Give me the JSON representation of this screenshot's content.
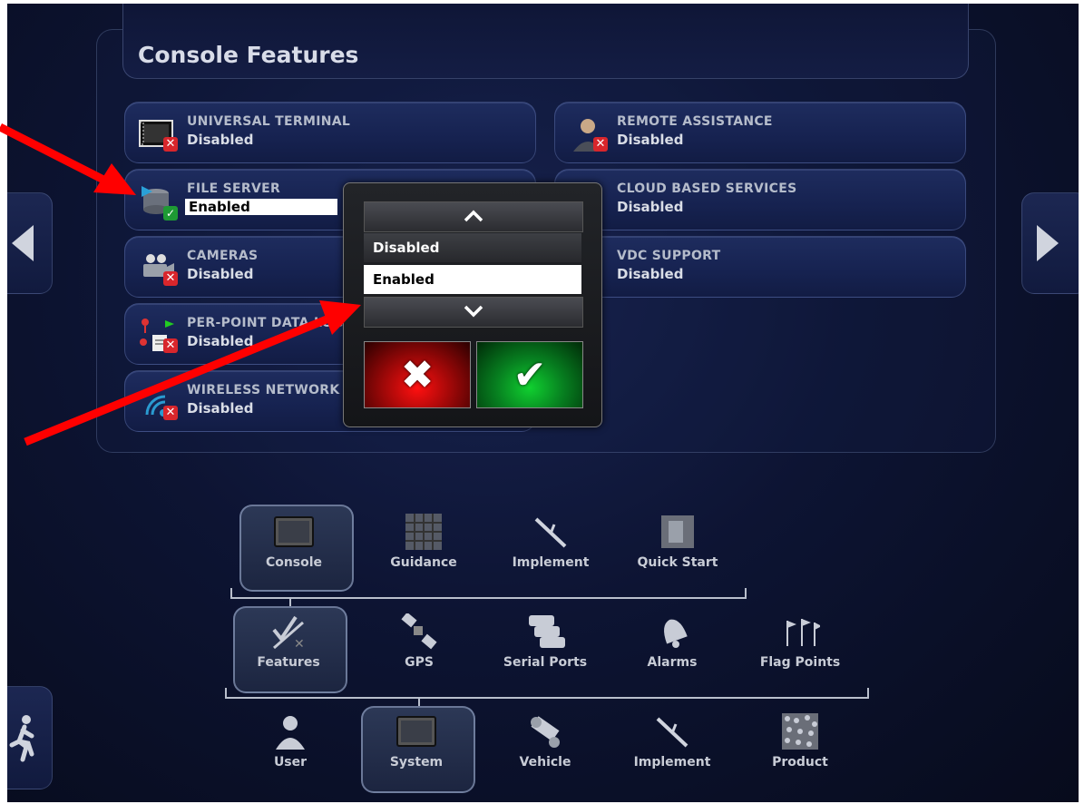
{
  "page_title": "Console Features",
  "features_left": [
    {
      "name": "UNIVERSAL TERMINAL",
      "value": "Disabled",
      "icon": "terminal-icon",
      "status": "disabled"
    },
    {
      "name": "FILE SERVER",
      "value": "Enabled",
      "icon": "file-server-icon",
      "status": "enabled"
    },
    {
      "name": "CAMERAS",
      "value": "Disabled",
      "icon": "camera-icon",
      "status": "disabled"
    },
    {
      "name": "PER-POINT DATA LOGGING",
      "value": "Disabled",
      "icon": "data-logging-icon",
      "status": "disabled"
    },
    {
      "name": "WIRELESS NETWORK",
      "value": "Disabled",
      "icon": "wireless-icon",
      "status": "disabled"
    }
  ],
  "features_right": [
    {
      "name": "REMOTE ASSISTANCE",
      "value": "Disabled",
      "icon": "remote-assistance-icon",
      "status": "disabled"
    },
    {
      "name": "CLOUD BASED SERVICES",
      "value": "Disabled",
      "icon": "cloud-icon",
      "status": "disabled"
    },
    {
      "name": "VDC SUPPORT",
      "value": "Disabled",
      "icon": "vdc-icon",
      "status": "disabled"
    }
  ],
  "picker": {
    "options": [
      "Disabled",
      "Enabled"
    ],
    "selected": "Enabled",
    "up_icon": "chevron-up-icon",
    "down_icon": "chevron-down-icon",
    "cancel_icon": "cross-icon",
    "confirm_icon": "check-icon"
  },
  "nav_level1": [
    "Console",
    "Guidance",
    "Implement",
    "Quick Start"
  ],
  "nav_level2": [
    "Features",
    "GPS",
    "Serial Ports",
    "Alarms",
    "Flag Points"
  ],
  "nav_level3": [
    "User",
    "System",
    "Vehicle",
    "Implement",
    "Product"
  ],
  "nav_selected": {
    "level1": "Console",
    "level2": "Features",
    "level3": "System"
  },
  "colors": {
    "annotation_arrow": "#ff0000",
    "enabled_green": "#1e9a34",
    "disabled_red": "#d8262c"
  }
}
